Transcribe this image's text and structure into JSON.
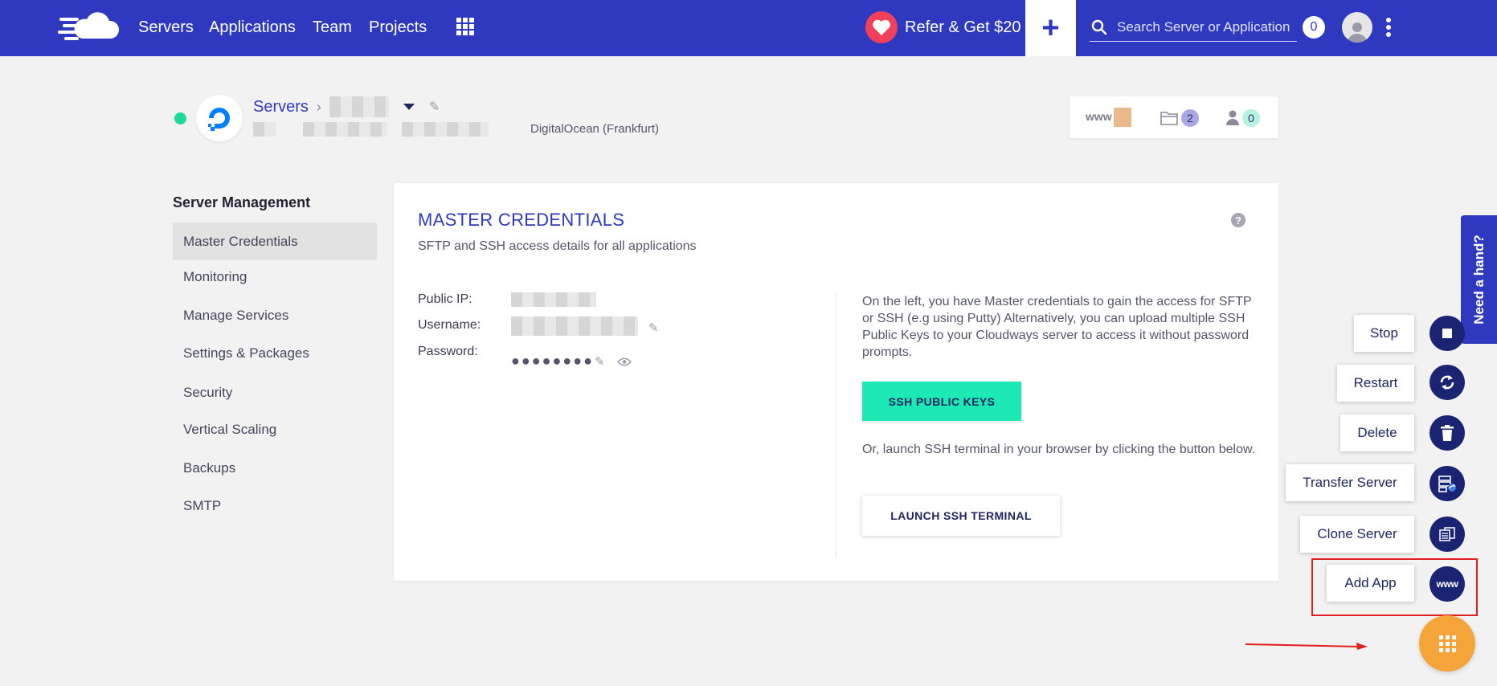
{
  "topbar": {
    "nav": [
      "Servers",
      "Applications",
      "Team",
      "Projects"
    ],
    "refer_label": "Refer & Get $20",
    "plus_symbol": "+",
    "search_placeholder": "Search Server or Application",
    "notification_count": "0",
    "colors": {
      "bar": "#2f39bf",
      "heart": "#f0405c"
    }
  },
  "server": {
    "breadcrumb_root": "Servers",
    "provider": "DigitalOcean (Frankfurt)",
    "status_color": "#1fd99b",
    "stats": {
      "www_label": "www",
      "folders": "2",
      "users": "0"
    }
  },
  "sidebar": {
    "title": "Server Management",
    "items": [
      {
        "label": "Master Credentials",
        "active": true
      },
      {
        "label": "Monitoring",
        "active": false
      },
      {
        "label": "Manage Services",
        "active": false
      },
      {
        "label": "Settings & Packages",
        "active": false
      },
      {
        "label": "Security",
        "active": false
      },
      {
        "label": "Vertical Scaling",
        "active": false
      },
      {
        "label": "Backups",
        "active": false
      },
      {
        "label": "SMTP",
        "active": false
      }
    ]
  },
  "credentials": {
    "title": "MASTER CREDENTIALS",
    "subtitle": "SFTP and SSH access details for all applications",
    "help_symbol": "?",
    "labels": {
      "public_ip": "Public IP:",
      "username": "Username:",
      "password": "Password:"
    },
    "password_mask": "●●●●●●●●",
    "info_text": "On the left, you have Master credentials to gain the access for SFTP or SSH (e.g using Putty) Alternatively, you can upload multiple SSH Public Keys to your Cloudways server to access it without password prompts.",
    "ssh_keys_button": "SSH PUBLIC KEYS",
    "or_text": "Or, launch SSH terminal in your browser by clicking the button below.",
    "terminal_button": "LAUNCH SSH TERMINAL",
    "accent_color": "#1de9b6"
  },
  "help_tab": {
    "label": "Need a hand?"
  },
  "actions": [
    {
      "label": "Stop",
      "icon": "stop-icon"
    },
    {
      "label": "Restart",
      "icon": "restart-icon"
    },
    {
      "label": "Delete",
      "icon": "trash-icon"
    },
    {
      "label": "Transfer Server",
      "icon": "transfer-server-icon"
    },
    {
      "label": "Clone Server",
      "icon": "clone-server-icon"
    },
    {
      "label": "Add App",
      "icon": "www-icon",
      "icon_text": "www"
    }
  ],
  "fab_color": "#f5a43a"
}
